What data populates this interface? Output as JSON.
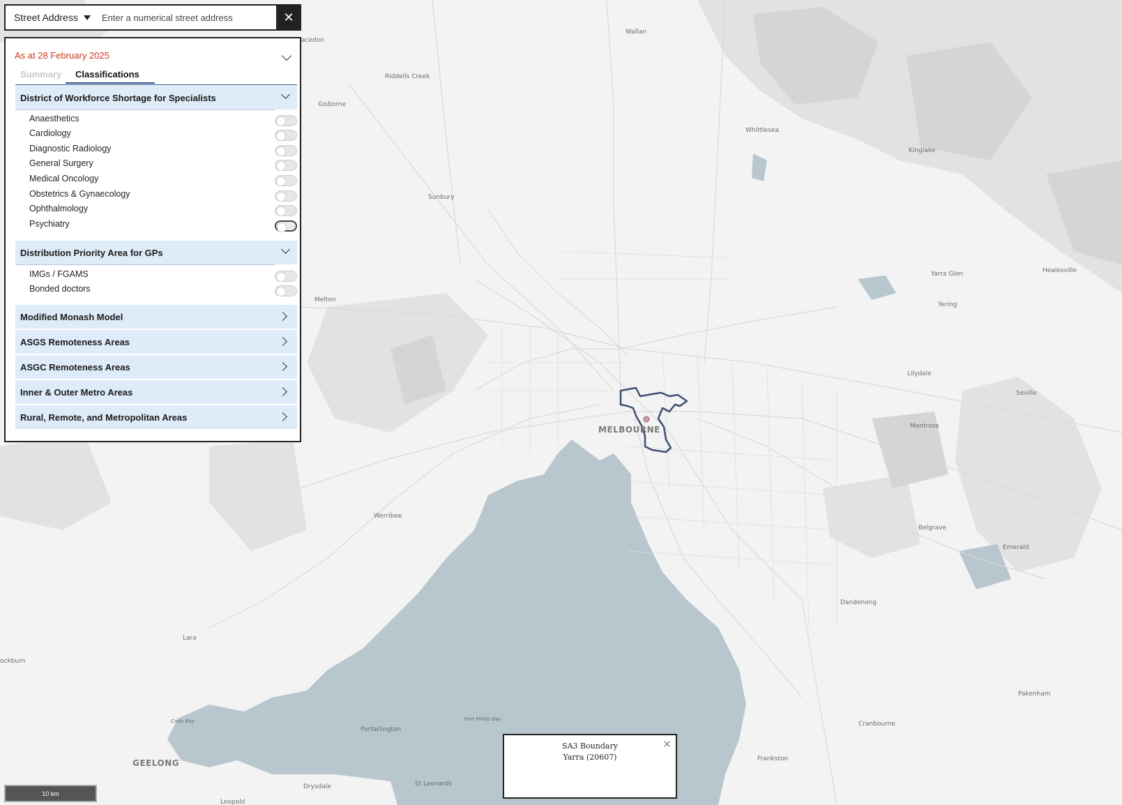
{
  "search": {
    "type_label": "Street Address",
    "placeholder": "Enter a numerical street address",
    "value": ""
  },
  "panel": {
    "as_at": "As at 28 February 2025",
    "tabs": [
      {
        "label": "Summary",
        "active": false
      },
      {
        "label": "Classifications",
        "active": true
      }
    ],
    "sections": {
      "dws": {
        "title": "District of Workforce Shortage for Specialists",
        "expanded": true,
        "items": [
          {
            "label": "Anaesthetics",
            "on": false
          },
          {
            "label": "Cardiology",
            "on": false
          },
          {
            "label": "Diagnostic Radiology",
            "on": false
          },
          {
            "label": "General Surgery",
            "on": false
          },
          {
            "label": "Medical Oncology",
            "on": false
          },
          {
            "label": "Obstetrics & Gynaecology",
            "on": false
          },
          {
            "label": "Ophthalmology",
            "on": false
          },
          {
            "label": "Psychiatry",
            "on": false
          }
        ]
      },
      "dpa": {
        "title": "Distribution Priority Area for GPs",
        "expanded": true,
        "items": [
          {
            "label": "IMGs / FGAMS",
            "on": false
          },
          {
            "label": "Bonded doctors",
            "on": false
          }
        ]
      },
      "collapsed": [
        {
          "title": "Modified Monash Model"
        },
        {
          "title": "ASGS Remoteness Areas"
        },
        {
          "title": "ASGC Remoteness Areas"
        },
        {
          "title": "Inner & Outer Metro Areas"
        },
        {
          "title": "Rural, Remote, and Metropolitan Areas"
        }
      ]
    }
  },
  "popup": {
    "title": "SA3 Boundary",
    "subtitle": "Yarra (20607)"
  },
  "scale_bar": "10 km",
  "map": {
    "places": {
      "macedon": "acedon",
      "wallan": "Wallan",
      "riddells_creek": "Riddells Creek",
      "gisborne": "Gisborne",
      "whittlesea": "Whittlesea",
      "kinglake": "Kinglake",
      "sunbury": "Sunbury",
      "yarra_glen": "Yarra Glen",
      "healesville": "Healesville",
      "yering": "Yering",
      "melton": "Melton",
      "lilydale": "Lilydale",
      "seville": "Seville",
      "melbourne": "MELBOURNE",
      "montrose": "Montrose",
      "werribee": "Werribee",
      "belgrave": "Belgrave",
      "emerald": "Emerald",
      "dandenong": "Dandenong",
      "lara": "Lara",
      "ockburn": "ockburn",
      "pakenham": "Pakenham",
      "cranbourne": "Cranbourne",
      "portarlington": "Portarlington",
      "geelong": "GEELONG",
      "frankston": "Frankston",
      "drysdale": "Drysdale",
      "st_leonards": "St Leonards",
      "leopold": "Leopold"
    },
    "water_labels": {
      "port_phillip_bay": "Port Phillip Bay",
      "corio_bay": "Corio Bay"
    },
    "colors": {
      "land": "#f3f3f4",
      "water": "#b8c6cd",
      "road": "#d9d9db",
      "boundary": "#3e4f6e",
      "marker": "#d19aa8"
    }
  }
}
